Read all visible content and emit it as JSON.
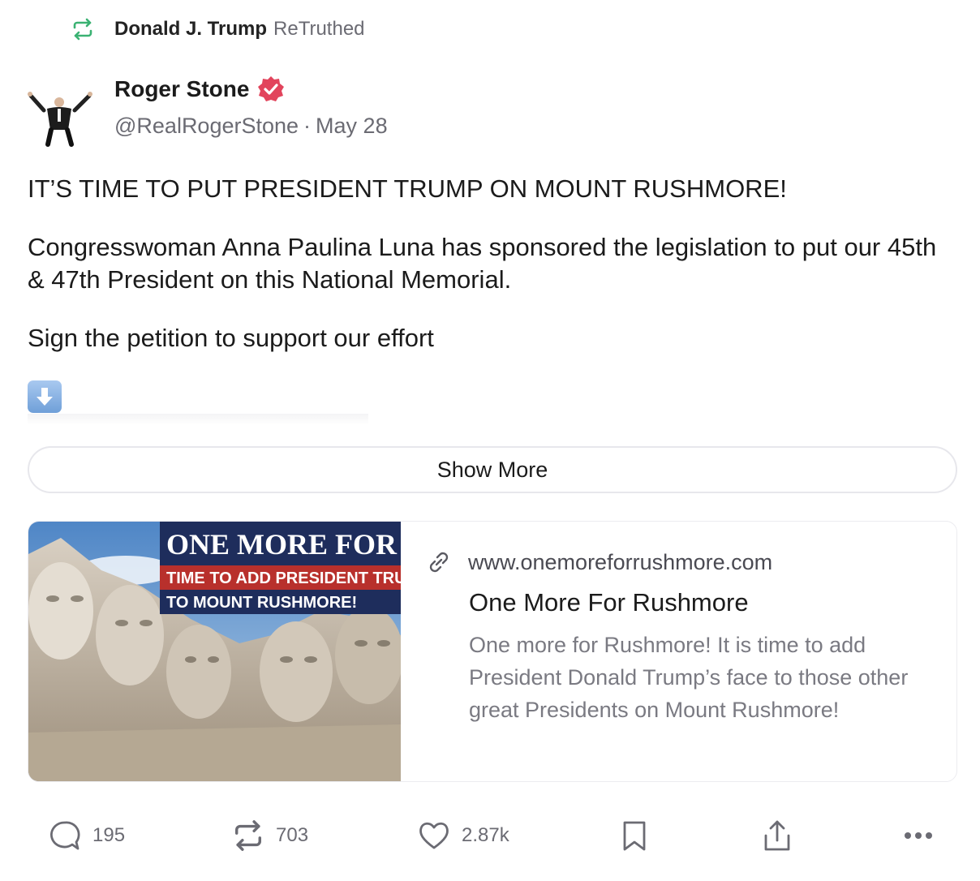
{
  "retruth": {
    "name": "Donald J. Trump",
    "verb": "ReTruthed",
    "icon": "retruth-icon",
    "accent": "#3bb273"
  },
  "author": {
    "name": "Roger Stone",
    "handle": "@RealRogerStone",
    "separator": "·",
    "date": "May 28",
    "verified_color": "#e2445c"
  },
  "post": {
    "headline": "IT’S TIME TO PUT PRESIDENT TRUMP ON MOUNT RUSHMORE!",
    "paragraph1": "Congresswoman Anna Paulina Luna has sponsored the legislation to put our 45th & 47th President on this National Memorial.",
    "paragraph2": "Sign the petition to support our effort",
    "emoji": "down-arrow-icon"
  },
  "show_more": "Show More",
  "link_card": {
    "image_banner_title": "ONE MORE FOR RUSHMORE",
    "image_banner_line1": "TIME TO ADD PRESIDENT TRUMP",
    "image_banner_line2": "TO MOUNT RUSHMORE!",
    "domain": "www.onemoreforrushmore.com",
    "title": "One More For Rushmore",
    "description": "One more for Rushmore! It is time to add President Donald Trump’s face to those other great Presidents on Mount Rushmore!"
  },
  "actions": {
    "replies": "195",
    "retruths": "703",
    "likes": "2.87k",
    "icons": [
      "comment-icon",
      "retruth-icon",
      "heart-icon",
      "bookmark-icon",
      "share-icon",
      "more-icon"
    ]
  }
}
